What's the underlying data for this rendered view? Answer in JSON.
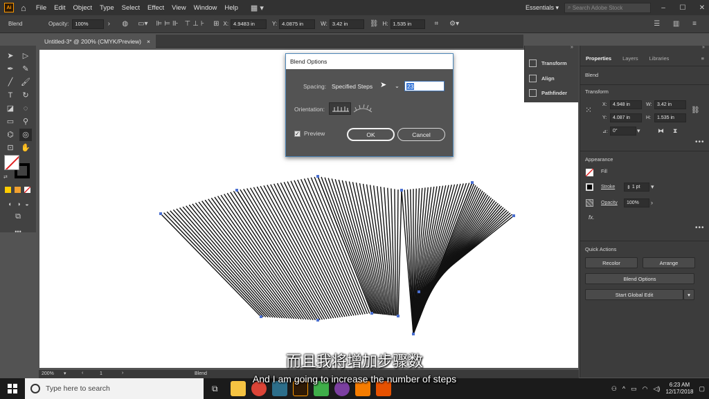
{
  "menubar": {
    "logo": "Ai",
    "menus": [
      "File",
      "Edit",
      "Object",
      "Type",
      "Select",
      "Effect",
      "View",
      "Window",
      "Help"
    ],
    "workspace": "Essentials",
    "search_placeholder": "Search Adobe Stock"
  },
  "control_bar": {
    "selection": "Blend",
    "opacity_label": "Opacity:",
    "opacity_value": "100%",
    "x_label": "X:",
    "x_value": "4.9483 in",
    "y_label": "Y:",
    "y_value": "4.0875 in",
    "w_label": "W:",
    "w_value": "3.42 in",
    "h_label": "H:",
    "h_value": "1.535 in"
  },
  "document_tab": {
    "title": "Untitled-3* @ 200% (CMYK/Preview)",
    "close": "×"
  },
  "dialog": {
    "title": "Blend Options",
    "spacing_label": "Spacing:",
    "spacing_value": "Specified Steps",
    "steps_value": "23",
    "orientation_label": "Orientation:",
    "preview_label": "Preview",
    "preview_checked": true,
    "ok_label": "OK",
    "cancel_label": "Cancel"
  },
  "mini_panel": {
    "items": [
      "Transform",
      "Align",
      "Pathfinder"
    ]
  },
  "properties": {
    "tabs": [
      "Properties",
      "Layers",
      "Libraries"
    ],
    "selection": "Blend",
    "transform_header": "Transform",
    "x_label": "X:",
    "x_value": "4.948 in",
    "y_label": "Y:",
    "y_value": "4.087 in",
    "w_label": "W:",
    "w_value": "3.42 in",
    "h_label": "H:",
    "h_value": "1.535 in",
    "angle_label": "⊿:",
    "angle_value": "0°",
    "appearance_header": "Appearance",
    "fill_label": "Fill",
    "stroke_label": "Stroke",
    "stroke_value": "1 pt",
    "opacity_label": "Opacity",
    "opacity_value": "100%",
    "fx_label": "fx.",
    "quick_actions_header": "Quick Actions",
    "recolor_label": "Recolor",
    "arrange_label": "Arrange",
    "blend_options_label": "Blend Options",
    "global_edit_label": "Start Global Edit"
  },
  "statusbar": {
    "zoom": "200%",
    "artboard": "1",
    "tool": "Blend"
  },
  "subtitles": {
    "chinese": "而且我将增加步骤数",
    "english": "And I am going to increase the number of steps"
  },
  "taskbar": {
    "search_placeholder": "Type here to search",
    "time": "6:23 AM",
    "date": "12/17/2018",
    "colors": {
      "start": "#ffffff",
      "explorer": "#f5c342",
      "chrome": "#db4437",
      "illustrator": "#ff9a00",
      "green": "#3fae49",
      "vlc": "#f57c00",
      "orange": "#e65100"
    }
  },
  "colors": {
    "accent": "#4c86b8",
    "stroke_lines": "#111111",
    "anchor": "#4a6fd0"
  }
}
